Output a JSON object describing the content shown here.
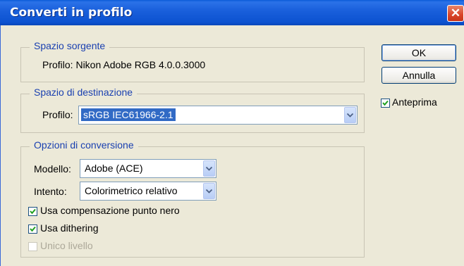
{
  "dialog": {
    "title": "Converti in profilo",
    "close_icon": "close-icon"
  },
  "source": {
    "legend": "Spazio sorgente",
    "profile_text": "Profilo: Nikon Adobe RGB 4.0.0.3000"
  },
  "destination": {
    "legend": "Spazio di destinazione",
    "profile_label": "Profilo:",
    "profile_value": "sRGB IEC61966-2.1"
  },
  "options": {
    "legend": "Opzioni di conversione",
    "engine_label": "Modello:",
    "engine_value": "Adobe (ACE)",
    "intent_label": "Intento:",
    "intent_value": "Colorimetrico relativo",
    "black_point_label": "Usa compensazione punto nero",
    "black_point_checked": true,
    "dither_label": "Usa dithering",
    "dither_checked": true,
    "flatten_label": "Unico livello",
    "flatten_checked": false
  },
  "buttons": {
    "ok": "OK",
    "cancel": "Annulla"
  },
  "preview": {
    "label": "Anteprima",
    "checked": true
  },
  "colors": {
    "titlebar": "#0c52d0",
    "legend_text": "#1a40b0",
    "selection": "#316ac5",
    "dialog_bg": "#ece9d8"
  }
}
